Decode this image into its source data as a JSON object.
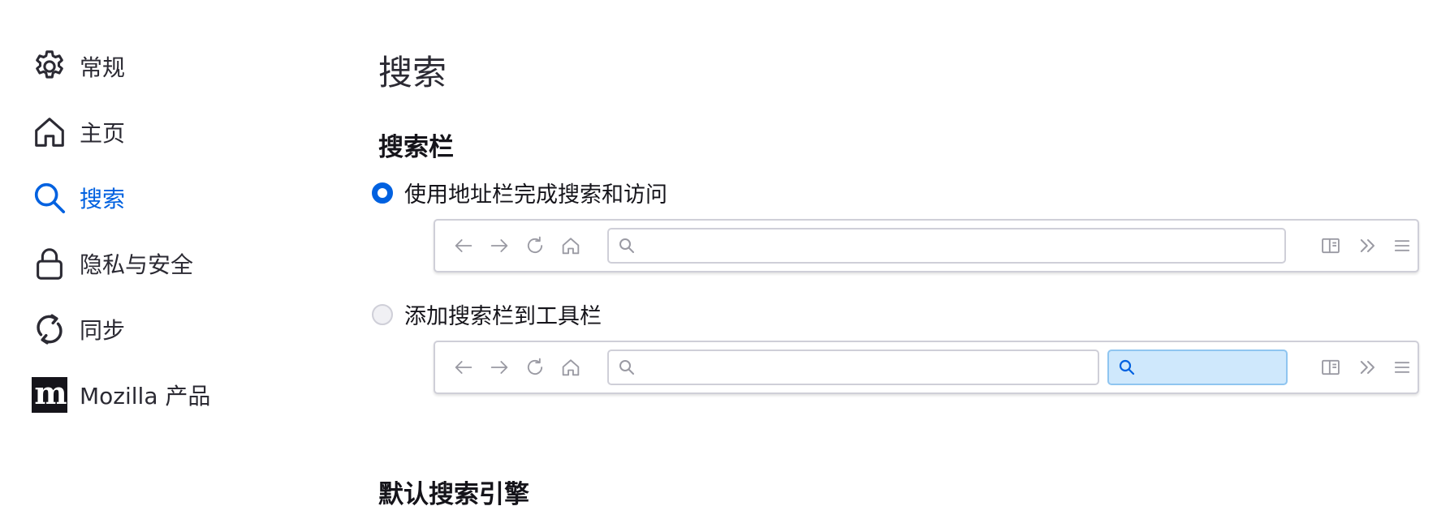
{
  "sidebar": {
    "items": [
      {
        "label": "常规",
        "icon": "gear-icon",
        "active": false
      },
      {
        "label": "主页",
        "icon": "home-icon",
        "active": false
      },
      {
        "label": "搜索",
        "icon": "search-icon",
        "active": true
      },
      {
        "label": "隐私与安全",
        "icon": "lock-icon",
        "active": false
      },
      {
        "label": "同步",
        "icon": "sync-icon",
        "active": false
      },
      {
        "label": "Mozilla 产品",
        "icon": "mozilla-logo-icon",
        "active": false
      }
    ]
  },
  "main": {
    "page_title": "搜索",
    "search_bar_section": {
      "title": "搜索栏",
      "options": [
        {
          "label": "使用地址栏完成搜索和访问",
          "selected": true
        },
        {
          "label": "添加搜索栏到工具栏",
          "selected": false
        }
      ]
    },
    "default_engine_section": {
      "title": "默认搜索引擎"
    },
    "toolbar_icons": [
      "back-icon",
      "forward-icon",
      "reload-icon",
      "home-icon",
      "sidebar-icon",
      "overflow-icon",
      "menu-icon"
    ]
  },
  "colors": {
    "accent": "#0061e0",
    "text": "#15141a",
    "border": "#cfcfd8",
    "searchbar_fill": "#cfe8fc"
  }
}
